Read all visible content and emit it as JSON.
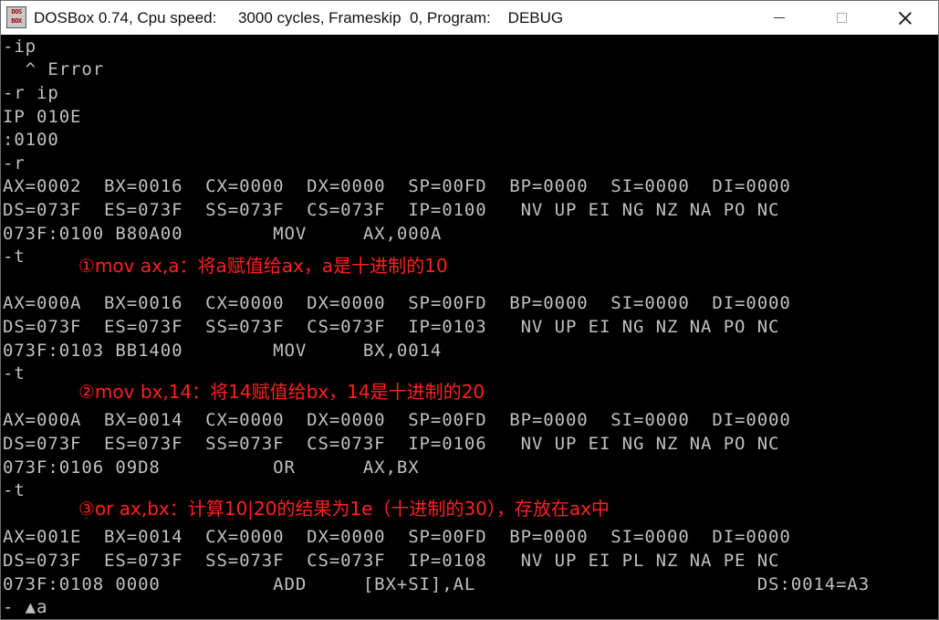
{
  "window": {
    "title": "DOSBox 0.74, Cpu speed:     3000 cycles, Frameskip  0, Program:    DEBUG",
    "icon_top": "DOS",
    "icon_bottom": "BOX",
    "minimize_icon": "minimize-icon",
    "maximize_icon": "maximize-icon",
    "close_icon": "close-icon"
  },
  "console": {
    "lines": [
      "-ip",
      "  ^ Error",
      "-r ip",
      "IP 010E",
      ":0100",
      "-r",
      "AX=0002  BX=0016  CX=0000  DX=0000  SP=00FD  BP=0000  SI=0000  DI=0000",
      "DS=073F  ES=073F  SS=073F  CS=073F  IP=0100   NV UP EI NG NZ NA PO NC",
      "073F:0100 B80A00        MOV     AX,000A",
      "-t",
      "",
      "AX=000A  BX=0016  CX=0000  DX=0000  SP=00FD  BP=0000  SI=0000  DI=0000",
      "DS=073F  ES=073F  SS=073F  CS=073F  IP=0103   NV UP EI NG NZ NA PO NC",
      "073F:0103 BB1400        MOV     BX,0014",
      "-t",
      "",
      "AX=000A  BX=0014  CX=0000  DX=0000  SP=00FD  BP=0000  SI=0000  DI=0000",
      "DS=073F  ES=073F  SS=073F  CS=073F  IP=0106   NV UP EI NG NZ NA PO NC",
      "073F:0106 09D8          OR      AX,BX",
      "-t",
      "",
      "AX=001E  BX=0014  CX=0000  DX=0000  SP=00FD  BP=0000  SI=0000  DI=0000",
      "DS=073F  ES=073F  SS=073F  CS=073F  IP=0108   NV UP EI PL NZ NA PE NC",
      "073F:0108 0000          ADD     [BX+SI],AL                         DS:0014=A3",
      "- ▲a"
    ],
    "annotations": [
      "①mov ax,a：将a赋值给ax，a是十进制的10",
      "②mov bx,14：将14赋值给bx，14是十进制的20",
      "③or ax,bx：计算10|20的结果为1e（十进制的30），存放在ax中"
    ]
  },
  "colors": {
    "console_bg": "#000000",
    "console_text": "#c0c0c0",
    "annotation": "#ff2020"
  }
}
